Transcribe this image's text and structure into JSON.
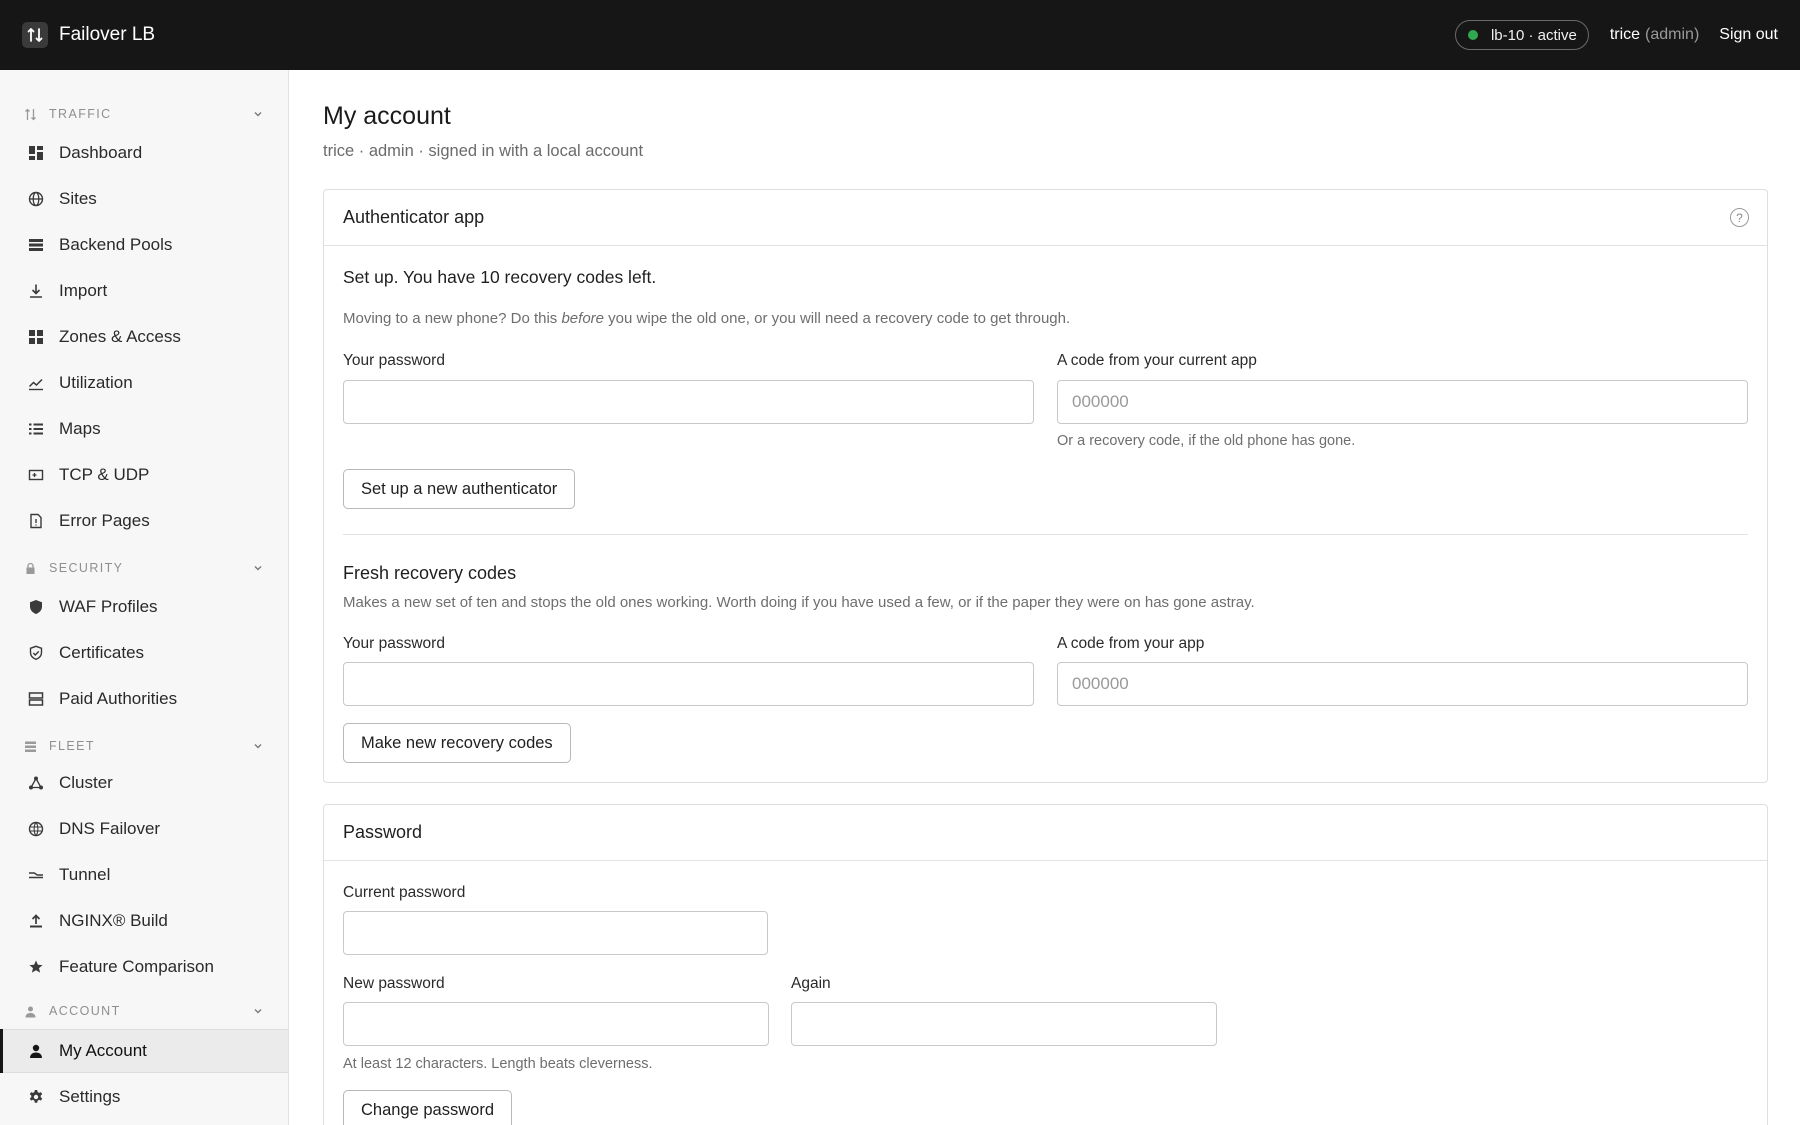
{
  "app": {
    "name": "Failover LB",
    "node_status": "lb-10 · active",
    "user": "trice",
    "role": "(admin)",
    "sign_out": "Sign out"
  },
  "sidebar": {
    "sections": [
      {
        "label": "TRAFFIC",
        "icon": "traffic-arrows-icon",
        "items": [
          {
            "label": "Dashboard",
            "icon": "dashboard-icon"
          },
          {
            "label": "Sites",
            "icon": "globe-icon"
          },
          {
            "label": "Backend Pools",
            "icon": "stack-icon"
          },
          {
            "label": "Import",
            "icon": "download-icon"
          },
          {
            "label": "Zones & Access",
            "icon": "grid-icon"
          },
          {
            "label": "Utilization",
            "icon": "line-chart-icon"
          },
          {
            "label": "Maps",
            "icon": "list-icon"
          },
          {
            "label": "TCP & UDP",
            "icon": "port-icon"
          },
          {
            "label": "Error Pages",
            "icon": "file-alert-icon"
          }
        ]
      },
      {
        "label": "SECURITY",
        "icon": "lock-icon",
        "items": [
          {
            "label": "WAF Profiles",
            "icon": "shield-icon"
          },
          {
            "label": "Certificates",
            "icon": "shield-check-icon"
          },
          {
            "label": "Paid Authorities",
            "icon": "server-icon"
          }
        ]
      },
      {
        "label": "FLEET",
        "icon": "fleet-icon",
        "items": [
          {
            "label": "Cluster",
            "icon": "cluster-icon"
          },
          {
            "label": "DNS Failover",
            "icon": "dns-globe-icon"
          },
          {
            "label": "Tunnel",
            "icon": "tunnel-icon"
          },
          {
            "label": "NGINX® Build",
            "icon": "upload-icon"
          },
          {
            "label": "Feature Comparison",
            "icon": "star-icon"
          }
        ]
      },
      {
        "label": "ACCOUNT",
        "icon": "person-icon",
        "items": [
          {
            "label": "My Account",
            "icon": "user-icon",
            "active": true
          },
          {
            "label": "Settings",
            "icon": "gear-icon"
          }
        ]
      }
    ]
  },
  "page": {
    "title": "My account",
    "subtitle": "trice · admin · signed in with a local account"
  },
  "auth_card": {
    "title": "Authenticator app",
    "help": "?",
    "status": "Set up. You have 10 recovery codes left.",
    "note_pre": "Moving to a new phone? Do this ",
    "note_em": "before",
    "note_post": " you wipe the old one, or you will need a recovery code to get through.",
    "password_label": "Your password",
    "code_label": "A code from your current app",
    "code_placeholder": "000000",
    "code_hint": "Or a recovery code, if the old phone has gone.",
    "setup_button": "Set up a new authenticator",
    "recovery": {
      "title": "Fresh recovery codes",
      "description": "Makes a new set of ten and stops the old ones working. Worth doing if you have used a few, or if the paper they were on has gone astray.",
      "password_label": "Your password",
      "code_label": "A code from your app",
      "code_placeholder": "000000",
      "button": "Make new recovery codes"
    }
  },
  "password_card": {
    "title": "Password",
    "current_label": "Current password",
    "new_label": "New password",
    "again_label": "Again",
    "hint": "At least 12 characters. Length beats cleverness.",
    "button": "Change password"
  },
  "colors": {
    "topbar": "#161616",
    "status_dot": "#2fa84f",
    "sidebar_bg": "#f7f7f7",
    "active_indicator": "#161616"
  }
}
